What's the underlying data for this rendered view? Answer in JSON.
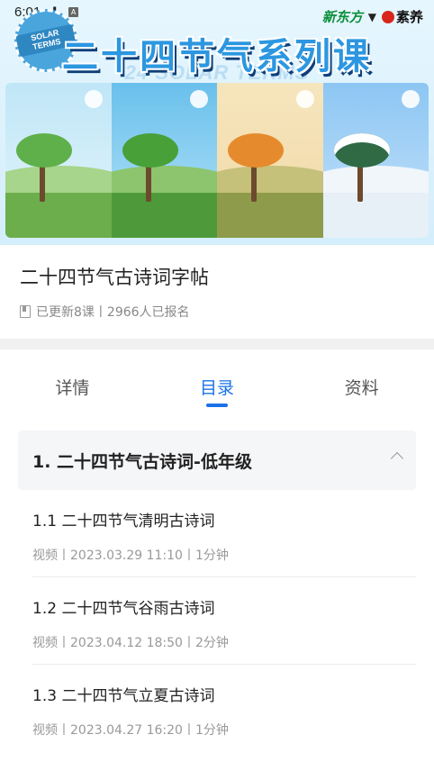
{
  "status_bar": {
    "time": "6:01",
    "icons": [
      "download-icon",
      "a-icon",
      "wifi-icon",
      "signal-icon",
      "battery-icon"
    ]
  },
  "banner": {
    "title": "二十四节气系列课",
    "subtitle": "24 SOLAR TERMS",
    "stamp_text": "SOLAR TERMS",
    "logo_left": "新东方",
    "logo_right": "素养",
    "seasons": [
      "spring",
      "summer",
      "autumn",
      "winter"
    ]
  },
  "course": {
    "title": "二十四节气古诗词字帖",
    "meta": "已更新8课丨2966人已报名"
  },
  "tabs": [
    {
      "label": "详情",
      "active": false
    },
    {
      "label": "目录",
      "active": true
    },
    {
      "label": "资料",
      "active": false
    }
  ],
  "catalog": {
    "section_title": "1. 二十四节气古诗词-低年级",
    "lessons": [
      {
        "title": "1.1 二十四节气清明古诗词",
        "info": "视频丨2023.03.29 11:10丨1分钟"
      },
      {
        "title": "1.2 二十四节气谷雨古诗词",
        "info": "视频丨2023.04.12 18:50丨2分钟"
      },
      {
        "title": "1.3 二十四节气立夏古诗词",
        "info": "视频丨2023.04.27 16:20丨1分钟"
      }
    ]
  },
  "colors": {
    "accent": "#1a73e8",
    "title_blue": "#2c97e0",
    "separator": "#f1f1f1"
  }
}
